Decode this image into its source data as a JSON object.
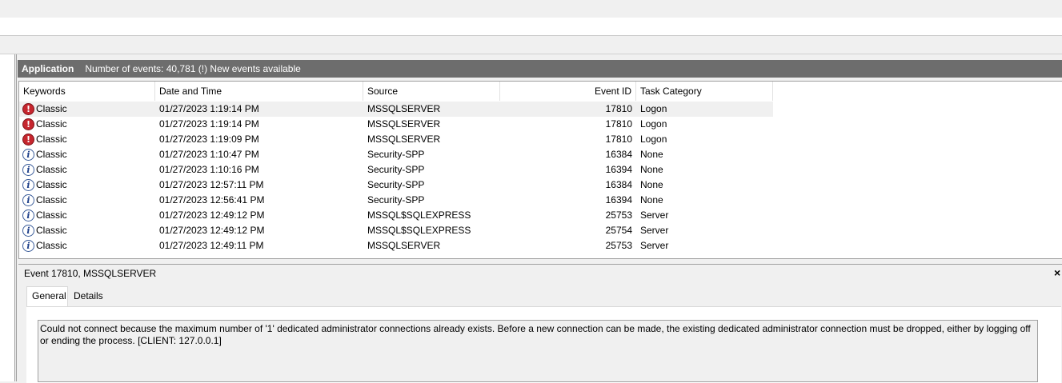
{
  "header": {
    "log_name": "Application",
    "event_count_text": "Number of events: 40,781 (!) New events available"
  },
  "columns": {
    "keywords": "Keywords",
    "date_time": "Date and Time",
    "source": "Source",
    "event_id": "Event ID",
    "task_category": "Task Category"
  },
  "events": [
    {
      "level_icon": "error-icon",
      "keywords": "Classic",
      "date_time": "01/27/2023 1:19:14 PM",
      "source": "MSSQLSERVER",
      "event_id": "17810",
      "task_category": "Logon"
    },
    {
      "level_icon": "error-icon",
      "keywords": "Classic",
      "date_time": "01/27/2023 1:19:14 PM",
      "source": "MSSQLSERVER",
      "event_id": "17810",
      "task_category": "Logon"
    },
    {
      "level_icon": "error-icon",
      "keywords": "Classic",
      "date_time": "01/27/2023 1:19:09 PM",
      "source": "MSSQLSERVER",
      "event_id": "17810",
      "task_category": "Logon"
    },
    {
      "level_icon": "info-icon",
      "keywords": "Classic",
      "date_time": "01/27/2023 1:10:47 PM",
      "source": "Security-SPP",
      "event_id": "16384",
      "task_category": "None"
    },
    {
      "level_icon": "info-icon",
      "keywords": "Classic",
      "date_time": "01/27/2023 1:10:16 PM",
      "source": "Security-SPP",
      "event_id": "16394",
      "task_category": "None"
    },
    {
      "level_icon": "info-icon",
      "keywords": "Classic",
      "date_time": "01/27/2023 12:57:11 PM",
      "source": "Security-SPP",
      "event_id": "16384",
      "task_category": "None"
    },
    {
      "level_icon": "info-icon",
      "keywords": "Classic",
      "date_time": "01/27/2023 12:56:41 PM",
      "source": "Security-SPP",
      "event_id": "16394",
      "task_category": "None"
    },
    {
      "level_icon": "info-icon",
      "keywords": "Classic",
      "date_time": "01/27/2023 12:49:12 PM",
      "source": "MSSQL$SQLEXPRESS",
      "event_id": "25753",
      "task_category": "Server"
    },
    {
      "level_icon": "info-icon",
      "keywords": "Classic",
      "date_time": "01/27/2023 12:49:12 PM",
      "source": "MSSQL$SQLEXPRESS",
      "event_id": "25754",
      "task_category": "Server"
    },
    {
      "level_icon": "info-icon",
      "keywords": "Classic",
      "date_time": "01/27/2023 12:49:11 PM",
      "source": "MSSQLSERVER",
      "event_id": "25753",
      "task_category": "Server"
    }
  ],
  "detail": {
    "title": "Event 17810, MSSQLSERVER",
    "close_glyph": "×",
    "tabs": [
      "General",
      "Details"
    ],
    "message": "Could not connect because the maximum number of '1' dedicated administrator connections already exists. Before a new connection can be made, the existing dedicated administrator connection must be dropped, either by logging off or ending the process. [CLIENT: 127.0.0.1]"
  },
  "colors": {
    "header_bg": "#6d6d6d",
    "error_icon": "#c6262e",
    "info_icon": "#3a5c9a"
  }
}
